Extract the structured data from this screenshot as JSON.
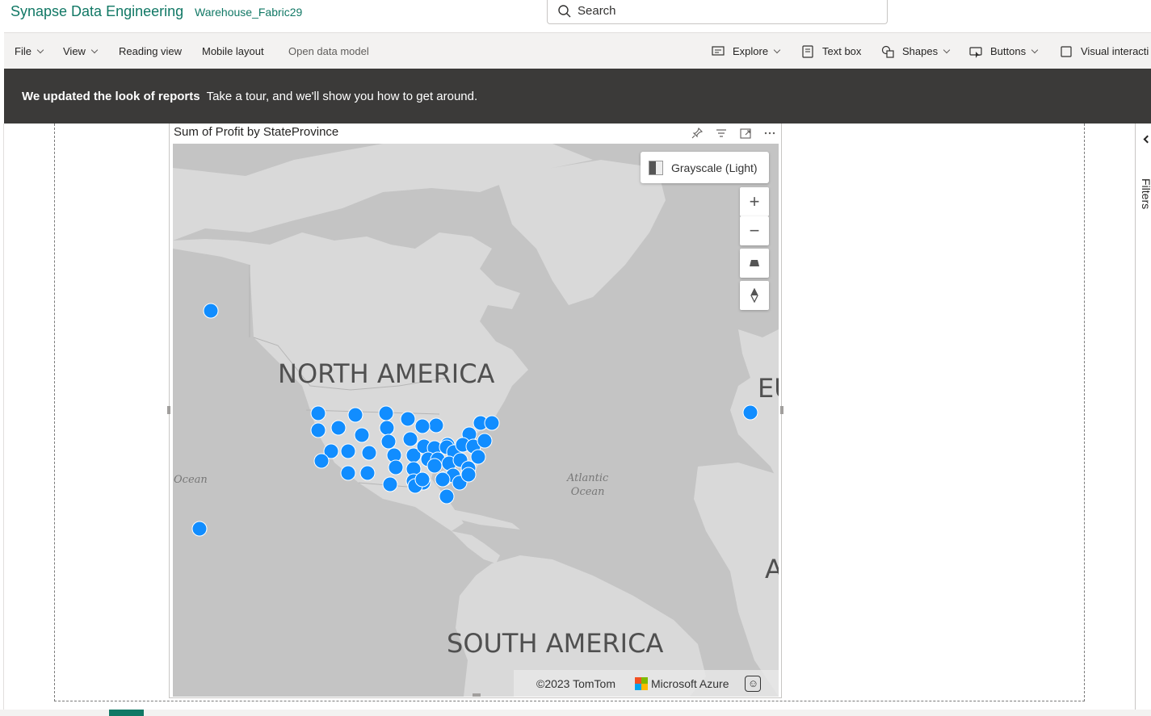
{
  "app": {
    "title": "Synapse Data Engineering",
    "workspace": "Warehouse_Fabric29",
    "search_placeholder": "Search"
  },
  "ribbon": {
    "left": [
      {
        "label": "File",
        "has_chevron": true
      },
      {
        "label": "View",
        "has_chevron": true
      },
      {
        "label": "Reading view",
        "has_chevron": false
      },
      {
        "label": "Mobile layout",
        "has_chevron": false
      },
      {
        "label": "Open data model",
        "has_chevron": false,
        "disabled": true
      }
    ],
    "right": [
      {
        "label": "Explore",
        "icon": "explore-icon",
        "has_chevron": true
      },
      {
        "label": "Text box",
        "icon": "text-box-icon",
        "has_chevron": false
      },
      {
        "label": "Shapes",
        "icon": "shapes-icon",
        "has_chevron": true
      },
      {
        "label": "Buttons",
        "icon": "buttons-icon",
        "has_chevron": true
      },
      {
        "label": "Visual interacti",
        "icon": "visual-interactions-icon",
        "has_chevron": false
      }
    ]
  },
  "banner": {
    "bold": "We updated the look of reports",
    "text": "Take a tour, and we'll show you how to get around."
  },
  "visual": {
    "title": "Sum of Profit by StateProvince",
    "map_style": "Grayscale (Light)",
    "labels": {
      "north_america": "NORTH AMERICA",
      "south_america": "SOUTH AMERICA",
      "europe_partial": "EU",
      "africa_partial": "A",
      "atlantic_ocean": "Atlantic\nOcean",
      "pacific_ocean": "Ocean"
    },
    "attribution": {
      "tomtom": "©2023 TomTom",
      "azure": "Microsoft Azure"
    }
  },
  "side_pane": {
    "filters_label": "Filters"
  },
  "colors": {
    "brand": "#117865",
    "bubble": "#118dff",
    "banner_bg": "#3b3a39",
    "ribbon_bg": "#f3f2f1"
  }
}
